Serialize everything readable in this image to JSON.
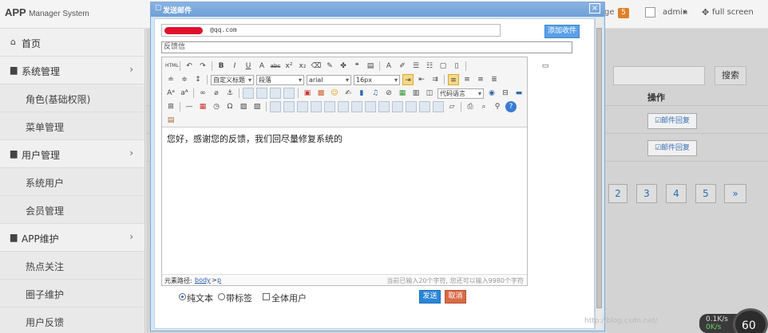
{
  "topbar": {
    "brand_app": "APP",
    "brand_rest": "Manager System",
    "message_label": "ge",
    "message_count": "5",
    "user_name": "admin",
    "user_caret": "▾",
    "fullscreen_label": "full screen"
  },
  "sidebar": {
    "items": [
      {
        "icon": "⌂",
        "label": "首页"
      },
      {
        "icon": "▆",
        "label": "系统管理",
        "chevron": "›"
      },
      {
        "label": "角色(基础权限)"
      },
      {
        "label": "菜单管理"
      },
      {
        "icon": "▆",
        "label": "用户管理",
        "chevron": "›"
      },
      {
        "label": "系统用户"
      },
      {
        "label": "会员管理"
      },
      {
        "icon": "▆",
        "label": "APP维护",
        "chevron": "›"
      },
      {
        "label": "热点关注"
      },
      {
        "label": "圈子维护"
      },
      {
        "label": "用户反馈"
      }
    ]
  },
  "main": {
    "search_button": "搜索",
    "column_header": "操作",
    "row_action": "☑邮件回复",
    "pages": [
      "2",
      "3",
      "4",
      "5",
      "»"
    ]
  },
  "dialog": {
    "title_icon": "☐",
    "title": "发送邮件",
    "close": "×",
    "to_value": "@qq.com",
    "select_recipient": "添加收件",
    "subject_value": "反馈信",
    "toolbar": {
      "custom_heading": "自定义标题",
      "paragraph": "段落",
      "font": "arial",
      "size": "16px",
      "code_language": "代码语言"
    },
    "content": "您好，感谢您的反馈，我们回尽量修复系统的",
    "path_label": "元素路径:",
    "path_body": "body",
    "path_sep": ">",
    "path_p": "p",
    "char_count": "当前已输入20个字符, 您还可以输入9980个字符",
    "options": {
      "plain_text": "纯文本",
      "with_tags": "带标签",
      "all_users": "全体用户"
    },
    "send": "发送",
    "cancel": "取消"
  },
  "watermark": "http://blog.csdn.net/",
  "net_widget": {
    "up": "0.1K/s",
    "down": "0K/s",
    "gauge": "60"
  }
}
